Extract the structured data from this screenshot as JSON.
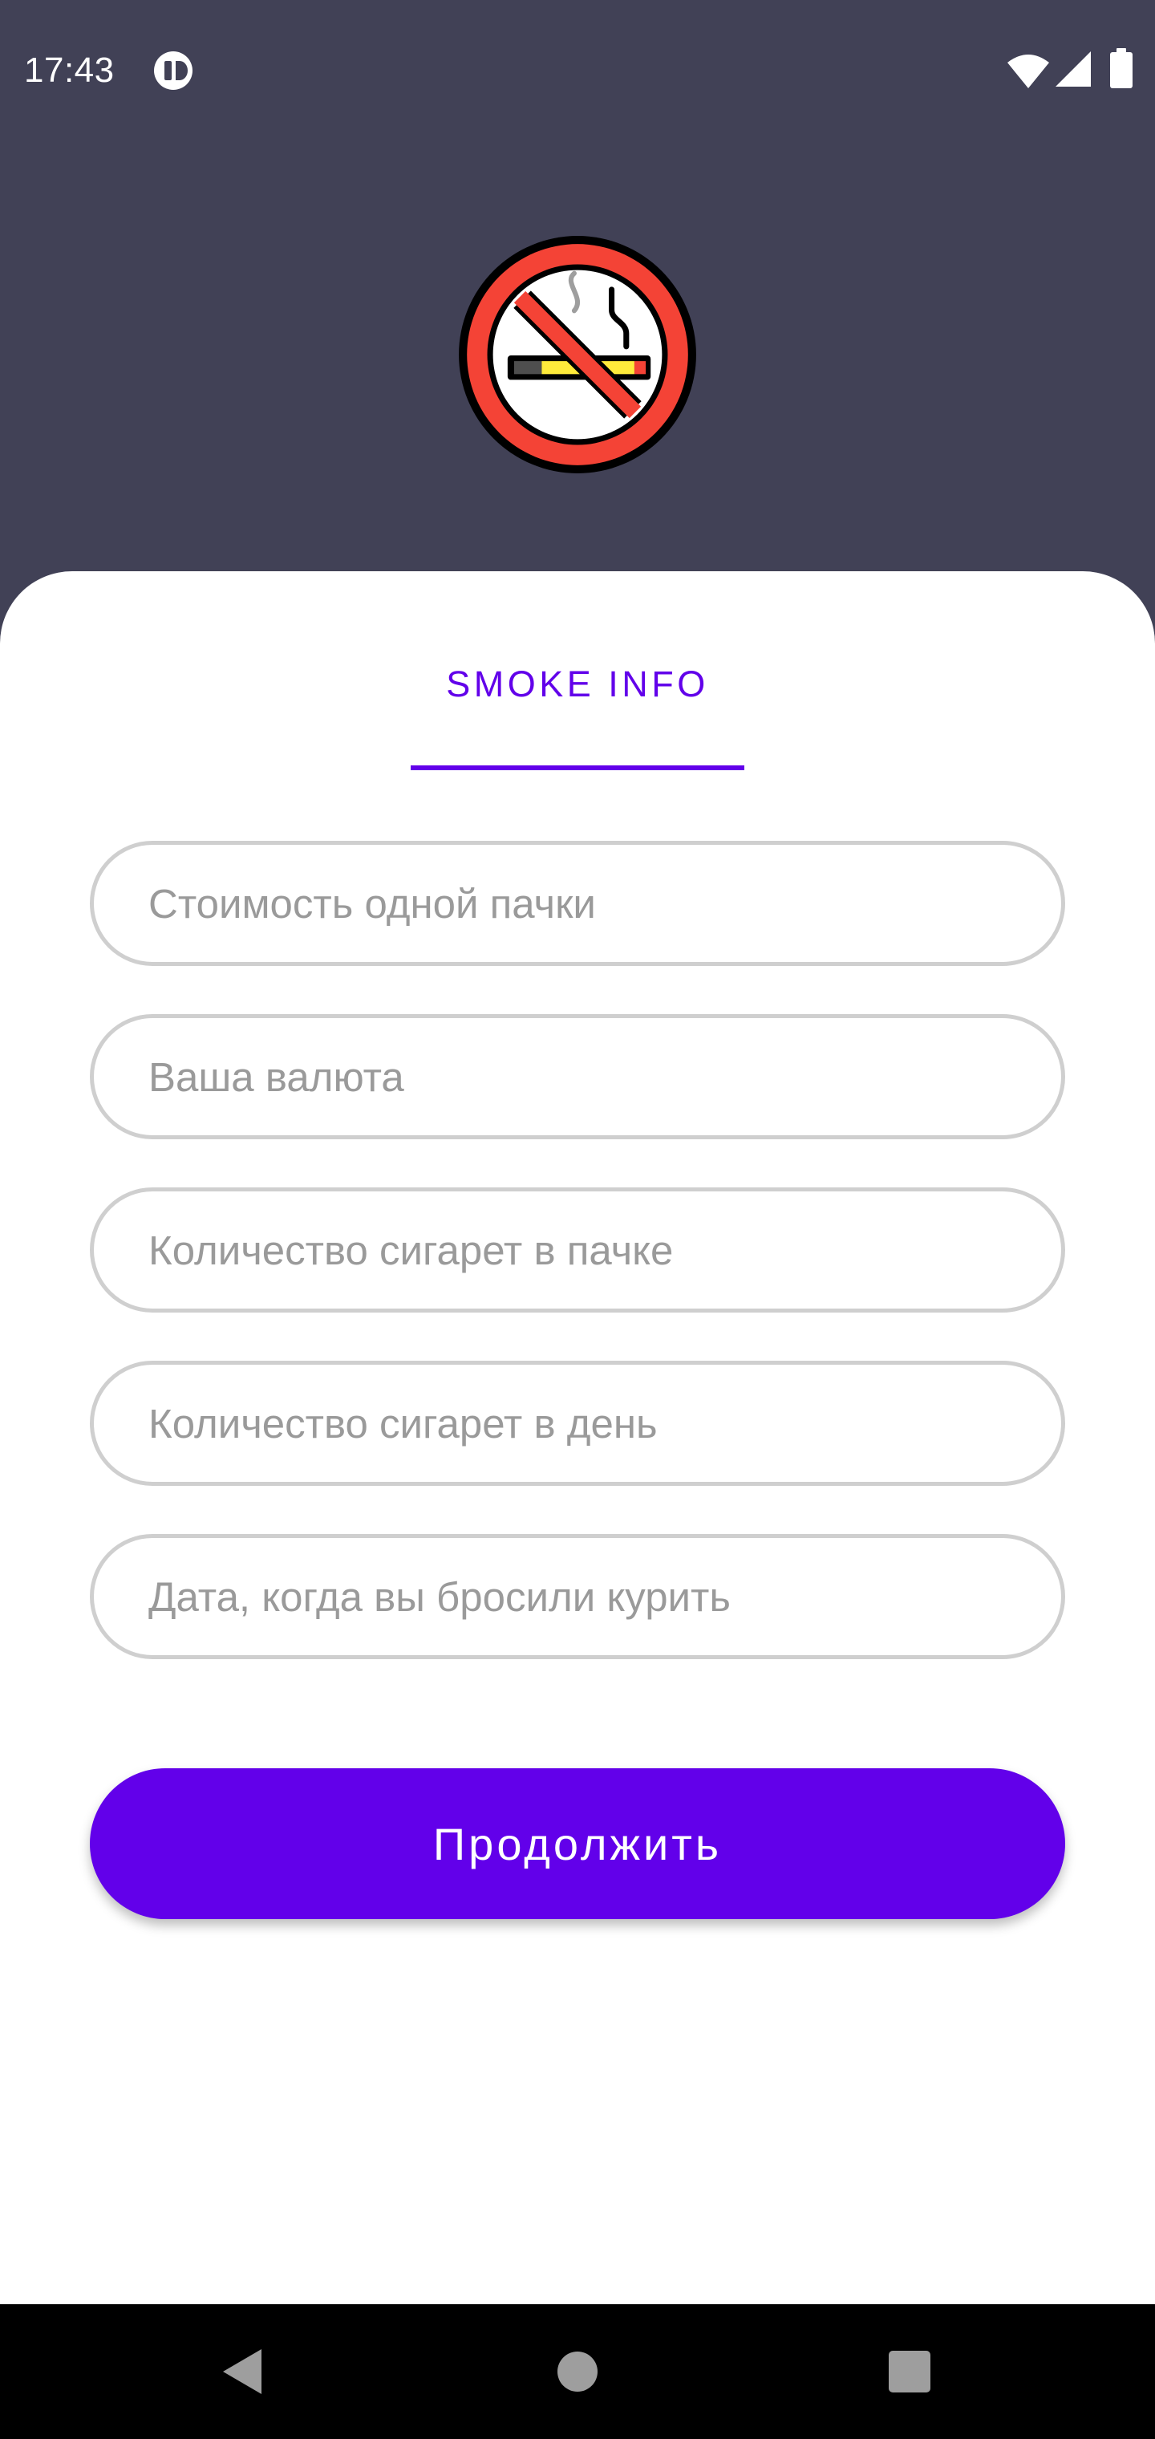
{
  "status_bar": {
    "time": "17:43",
    "icons": [
      "app-notification-icon",
      "wifi-icon",
      "signal-icon",
      "battery-icon"
    ]
  },
  "header": {
    "logo": "no-smoking-icon",
    "colors": {
      "background": "#414156",
      "logo_ring": "#f44336"
    }
  },
  "tab": {
    "label": "SMOKE INFO"
  },
  "form": {
    "fields": [
      {
        "placeholder": "Стоимость одной пачки",
        "value": ""
      },
      {
        "placeholder": "Ваша валюта",
        "value": ""
      },
      {
        "placeholder": "Количество сигарет в пачке",
        "value": ""
      },
      {
        "placeholder": "Количество сигарет в день",
        "value": ""
      },
      {
        "placeholder": "Дата, когда вы бросили курить",
        "value": ""
      }
    ],
    "submit_label": "Продолжить"
  },
  "nav_bar": {
    "icons": [
      "back-icon",
      "home-icon",
      "recents-icon"
    ]
  },
  "colors": {
    "accent": "#6200ea",
    "field_border": "#cfcfcf",
    "placeholder": "#9a9a9a"
  }
}
